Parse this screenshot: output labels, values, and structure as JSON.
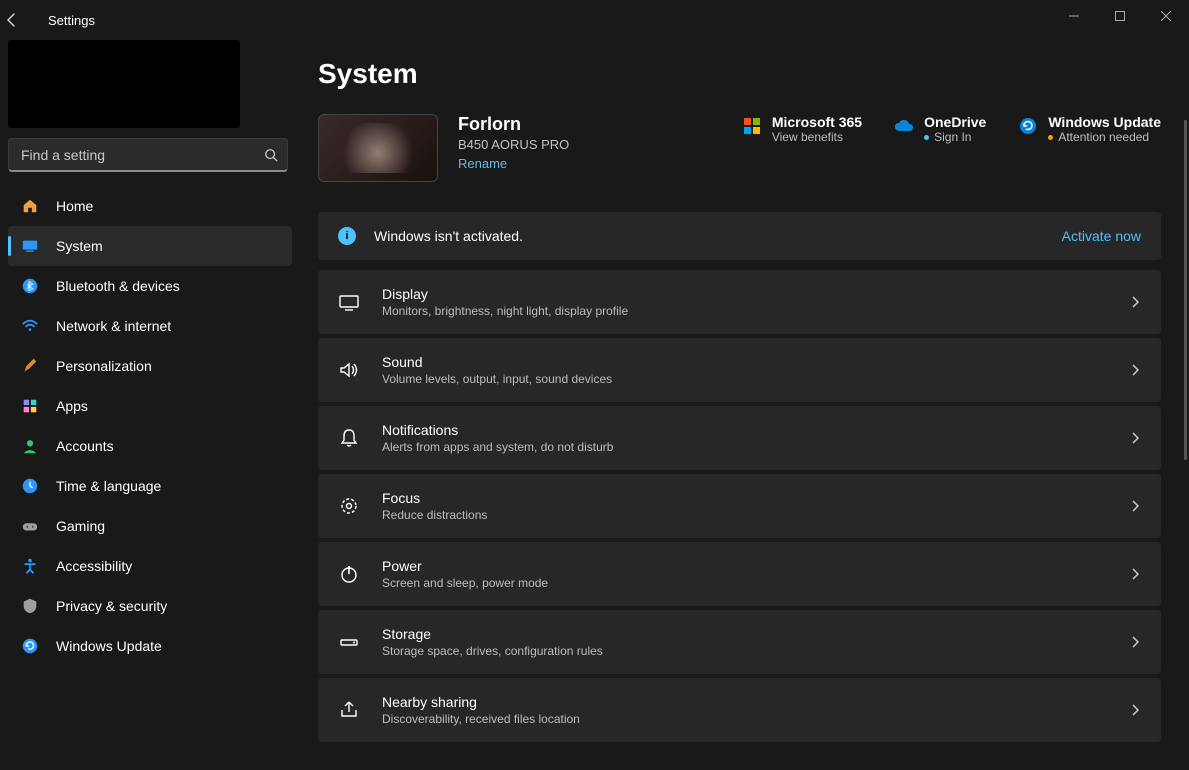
{
  "titlebar": {
    "title": "Settings"
  },
  "search": {
    "placeholder": "Find a setting"
  },
  "nav": {
    "items": [
      {
        "label": "Home"
      },
      {
        "label": "System"
      },
      {
        "label": "Bluetooth & devices"
      },
      {
        "label": "Network & internet"
      },
      {
        "label": "Personalization"
      },
      {
        "label": "Apps"
      },
      {
        "label": "Accounts"
      },
      {
        "label": "Time & language"
      },
      {
        "label": "Gaming"
      },
      {
        "label": "Accessibility"
      },
      {
        "label": "Privacy & security"
      },
      {
        "label": "Windows Update"
      }
    ]
  },
  "page": {
    "title": "System",
    "pc": {
      "name": "Forlorn",
      "model": "B450 AORUS PRO",
      "rename": "Rename"
    },
    "status": {
      "m365": {
        "title": "Microsoft 365",
        "sub": "View benefits"
      },
      "onedrive": {
        "title": "OneDrive",
        "sub": "Sign In"
      },
      "update": {
        "title": "Windows Update",
        "sub": "Attention needed"
      }
    },
    "banner": {
      "message": "Windows isn't activated.",
      "action": "Activate now"
    },
    "cards": [
      {
        "title": "Display",
        "desc": "Monitors, brightness, night light, display profile"
      },
      {
        "title": "Sound",
        "desc": "Volume levels, output, input, sound devices"
      },
      {
        "title": "Notifications",
        "desc": "Alerts from apps and system, do not disturb"
      },
      {
        "title": "Focus",
        "desc": "Reduce distractions"
      },
      {
        "title": "Power",
        "desc": "Screen and sleep, power mode"
      },
      {
        "title": "Storage",
        "desc": "Storage space, drives, configuration rules"
      },
      {
        "title": "Nearby sharing",
        "desc": "Discoverability, received files location"
      }
    ]
  }
}
